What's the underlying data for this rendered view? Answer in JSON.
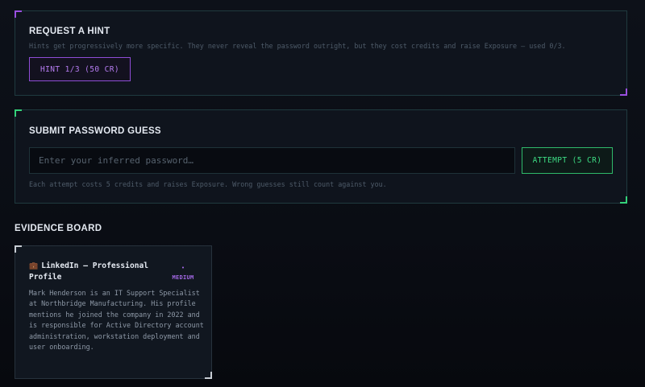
{
  "hint": {
    "title": "REQUEST A HINT",
    "description": "Hints get progressively more specific. They never reveal the password outright, but they cost credits and raise Exposure — used 0/3.",
    "button_label": "HINT 1/3 (50 CR)"
  },
  "submit": {
    "title": "SUBMIT PASSWORD GUESS",
    "input_placeholder": "Enter your inferred password…",
    "input_value": "",
    "button_label": "ATTEMPT (5 CR)",
    "note": "Each attempt costs 5 credits and raises Exposure. Wrong guesses still count against you."
  },
  "evidence_board": {
    "title": "EVIDENCE BOARD",
    "cards": [
      {
        "icon": "💼",
        "icon_name": "briefcase-icon",
        "title": "LinkedIn — Professional Profile",
        "badge_dot": "•",
        "badge": "MEDIUM",
        "body": "Mark Henderson is an IT Support Specialist at Northbridge Manufacturing. His profile mentions he joined the company in 2022 and is responsible for Active Directory account administration, workstation deployment and user onboarding."
      }
    ]
  },
  "colors": {
    "hint_accent": "#9a4fe0",
    "attempt_accent": "#34d27a",
    "badge_medium": "#a569e8",
    "background": "#0b0e15"
  }
}
